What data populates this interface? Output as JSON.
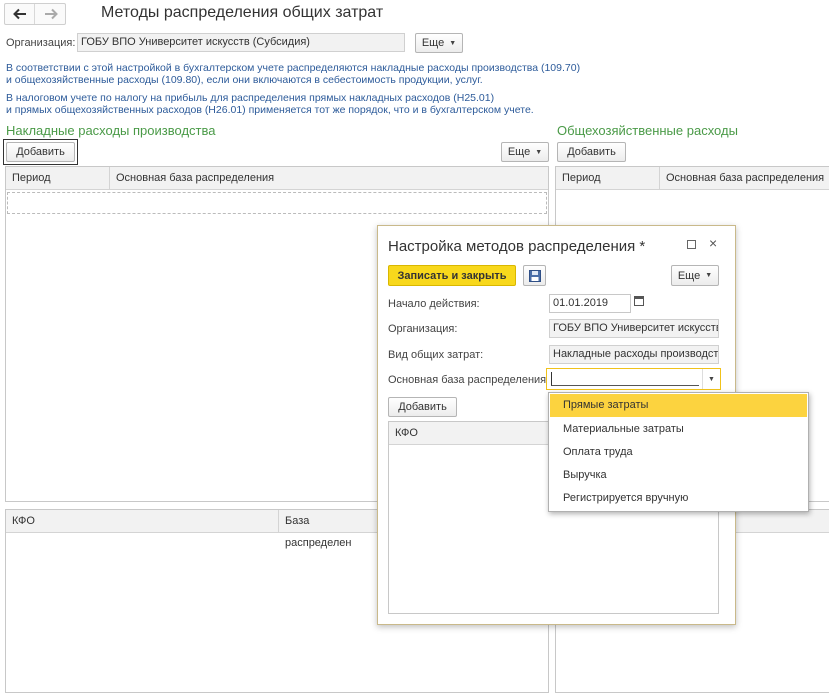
{
  "nav": {
    "back_icon": "arrow-left-icon",
    "forward_icon": "arrow-right-icon"
  },
  "page": {
    "title": "Методы распределения общих затрат"
  },
  "org": {
    "label": "Организация:",
    "value": "ГОБУ ВПО Университет искусств (Субсидия)",
    "more_label": "Еще"
  },
  "info": {
    "line1": "В соответствии с этой настройкой в бухгалтерском учете распределяются накладные расходы производства (109.70)",
    "line2": "и общехозяйственные расходы (109.80), если они включаются в себестоимость продукции, услуг.",
    "line3": "В налоговом учете по налогу на прибыль для распределения прямых накладных расходов (Н25.01)",
    "line4": "и прямых общехозяйственных расходов (Н26.01) применяется тот же порядок, что и в бухгалтерском учете."
  },
  "left": {
    "title": "Накладные расходы производства",
    "add_label": "Добавить",
    "more_label": "Еще",
    "columns": [
      "Период",
      "Основная база распределения"
    ],
    "bottom_columns": [
      "КФО",
      "База распределен"
    ]
  },
  "right": {
    "title": "Общехозяйственные расходы",
    "add_label": "Добавить",
    "columns": [
      "Период",
      "Основная база распределения"
    ]
  },
  "dialog": {
    "title": "Настройка методов распределения *",
    "save_close_label": "Записать и закрыть",
    "more_label": "Еще",
    "start_label": "Начало действия:",
    "start_value": "01.01.2019",
    "org_label": "Организация:",
    "org_value": "ГОБУ ВПО Университет искусств (Субсидия)",
    "cost_type_label": "Вид общих затрат:",
    "cost_type_value": "Накладные расходы производства",
    "base_label": "Основная база распределения:",
    "base_value": "",
    "add_label": "Добавить",
    "table_columns": [
      "КФО"
    ]
  },
  "dropdown": {
    "options": [
      "Прямые затраты",
      "Материальные затраты",
      "Оплата труда",
      "Выручка",
      "Регистрируется вручную"
    ],
    "highlighted_index": 0
  },
  "colors": {
    "accent_yellow": "#f8d81c",
    "section_green": "#4a9a47",
    "info_blue": "#2d5b9a",
    "highlight": "#fcd33f"
  }
}
